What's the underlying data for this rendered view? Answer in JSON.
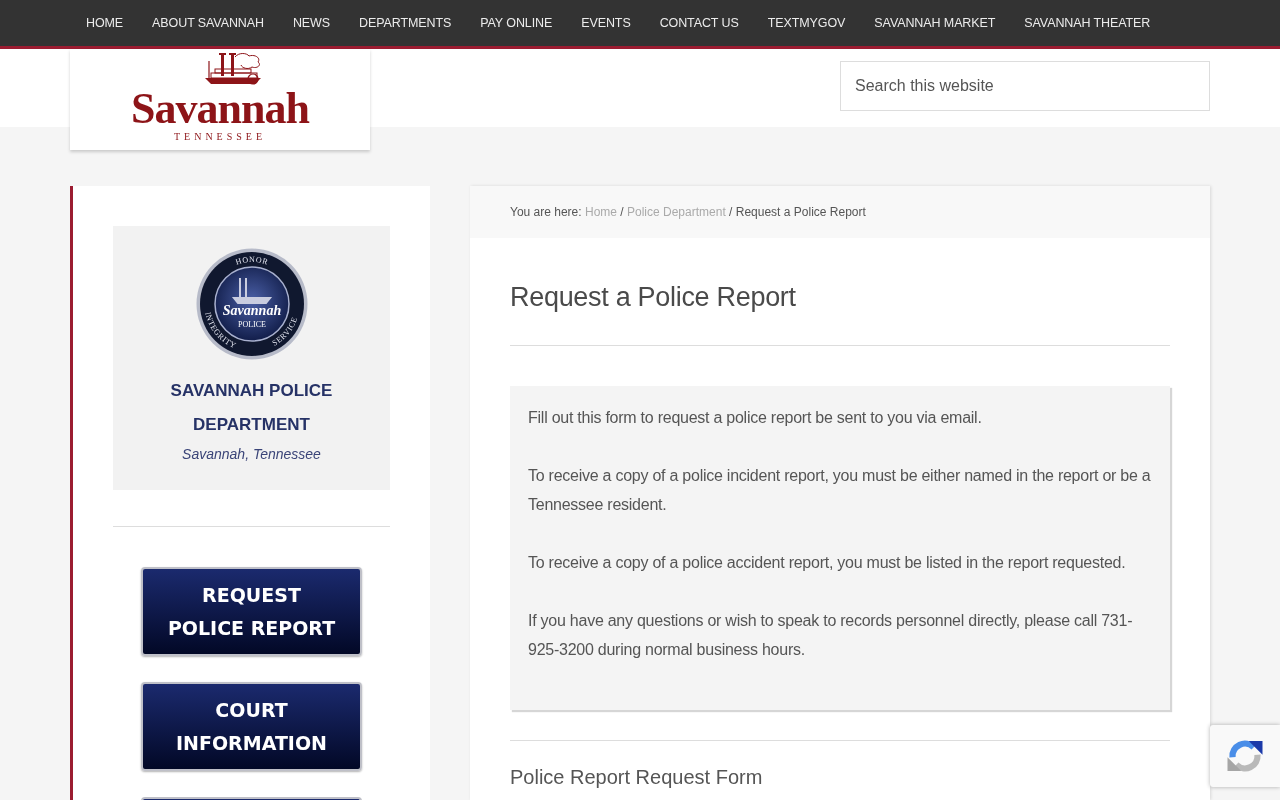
{
  "nav": [
    {
      "label": "HOME"
    },
    {
      "label": "ABOUT SAVANNAH"
    },
    {
      "label": "NEWS"
    },
    {
      "label": "DEPARTMENTS"
    },
    {
      "label": "PAY ONLINE"
    },
    {
      "label": "EVENTS"
    },
    {
      "label": "CONTACT US"
    },
    {
      "label": "TEXTMYGOV"
    },
    {
      "label": "SAVANNAH MARKET"
    },
    {
      "label": "SAVANNAH THEATER"
    }
  ],
  "header": {
    "logo": {
      "name": "Savannah",
      "tagline": "TENNESSEE"
    },
    "search": {
      "placeholder": "Search this website"
    }
  },
  "sidebar": {
    "seal": {
      "ring": [
        {
          "kind": "top",
          "text": "HONOR"
        },
        {
          "kind": "left",
          "text": "INTEGRITY"
        },
        {
          "kind": "right",
          "text": "SERVICE"
        }
      ],
      "name": "Savannah",
      "caption": "POLICE"
    },
    "title": "SAVANNAH POLICE DEPARTMENT",
    "subtitle": "Savannah, Tennessee",
    "buttons": [
      {
        "kind": "label",
        "lines": [
          "REQUEST",
          "POLICE REPORT"
        ]
      },
      {
        "kind": "label",
        "lines": [
          "COURT",
          "INFORMATION"
        ]
      },
      {
        "kind": "cut"
      }
    ]
  },
  "breadcrumb": [
    {
      "kind": "text",
      "text": "You are here:"
    },
    {
      "kind": "link",
      "text": "Home"
    },
    {
      "kind": "text",
      "text": "/"
    },
    {
      "kind": "link",
      "text": "Police Department"
    },
    {
      "kind": "text",
      "text": "/ Request a Police Report"
    }
  ],
  "page": {
    "title": "Request a Police Report",
    "notice": [
      "Fill out this form to request a police report be sent to you via email.",
      "To receive a copy of a police incident report, you must be either named in the report or be a Tennessee resident.",
      "To receive a copy of a police accident report, you must be listed in the report requested.",
      "If you have any questions or wish to speak to records personnel directly, please call 731-925-3200 during normal business hours."
    ],
    "form_heading": "Police Report Request Form"
  }
}
